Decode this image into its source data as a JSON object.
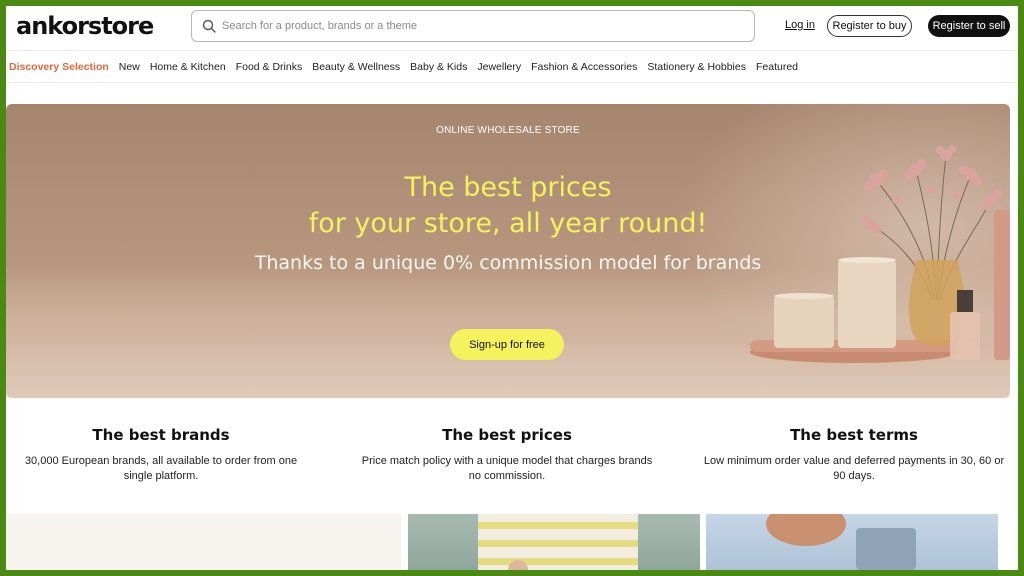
{
  "header": {
    "logo": "ankorstore",
    "search_placeholder": "Search for a product, brands or a theme",
    "login_label": "Log in",
    "register_buy_label": "Register to buy",
    "register_sell_label": "Register to sell"
  },
  "nav": {
    "items": [
      "Discovery Selection",
      "New",
      "Home & Kitchen",
      "Food & Drinks",
      "Beauty & Wellness",
      "Baby & Kids",
      "Jewellery",
      "Fashion & Accessories",
      "Stationery & Hobbies",
      "Featured"
    ],
    "active_index": 0
  },
  "hero": {
    "kicker": "ONLINE WHOLESALE STORE",
    "title_line1": "The best prices",
    "title_line2": "for your store, all year round!",
    "subtitle": "Thanks to a unique 0% commission model for brands",
    "cta_label": "Sign-up for free"
  },
  "features": [
    {
      "title": "The best brands",
      "text": "30,000 European brands, all available to order from one single platform."
    },
    {
      "title": "The best prices",
      "text": "Price match policy with a unique model that charges brands no commission."
    },
    {
      "title": "The best terms",
      "text": "Low minimum order value and deferred payments in 30, 60 or 90 days."
    }
  ],
  "colors": {
    "accent_orange": "#e2663a",
    "accent_yellow": "#f6f25e",
    "border_green": "#4a8a14"
  }
}
